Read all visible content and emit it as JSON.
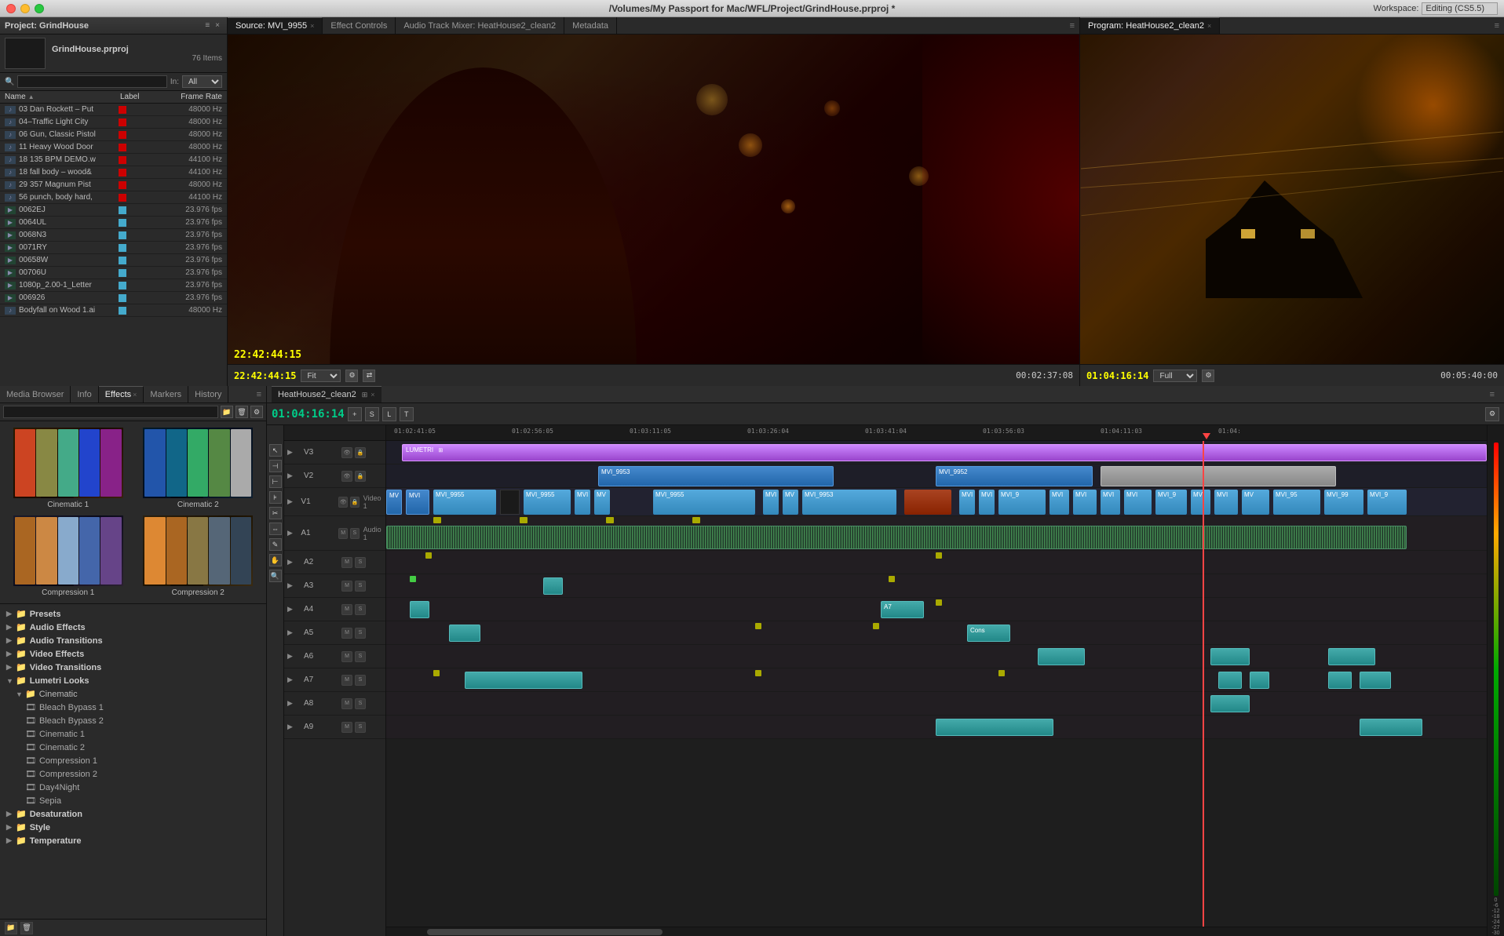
{
  "window": {
    "title": "/Volumes/My Passport for Mac/WFL/Project/GrindHouse.prproj *",
    "workspace_label": "Workspace:",
    "workspace_value": "Editing (CS5.5)"
  },
  "window_controls": {
    "close": "●",
    "minimize": "●",
    "maximize": "●"
  },
  "project_panel": {
    "title": "Project: GrindHouse",
    "close_btn": "×",
    "menu_btn": "≡",
    "project_name": "GrindHouse.prproj",
    "item_count": "76 Items",
    "search_placeholder": "",
    "in_label": "In:",
    "in_value": "All",
    "columns": {
      "name": "Name",
      "label": "Label",
      "frame_rate": "Frame Rate"
    },
    "items": [
      {
        "name": "03 Dan Rockett – Put",
        "color": "#cc0000",
        "rate": "48000 Hz",
        "type": "audio"
      },
      {
        "name": "04–Traffic Light City",
        "color": "#cc0000",
        "rate": "48000 Hz",
        "type": "audio"
      },
      {
        "name": "06 Gun, Classic Pistol",
        "color": "#cc0000",
        "rate": "48000 Hz",
        "type": "audio"
      },
      {
        "name": "11 Heavy Wood Door",
        "color": "#cc0000",
        "rate": "48000 Hz",
        "type": "audio"
      },
      {
        "name": "18 135 BPM DEMO.w",
        "color": "#cc0000",
        "rate": "44100 Hz",
        "type": "audio"
      },
      {
        "name": "18 fall body – wood&",
        "color": "#cc0000",
        "rate": "44100 Hz",
        "type": "audio"
      },
      {
        "name": "29 357 Magnum Pist",
        "color": "#cc0000",
        "rate": "48000 Hz",
        "type": "audio"
      },
      {
        "name": "56 punch, body hard,",
        "color": "#cc0000",
        "rate": "44100 Hz",
        "type": "audio"
      },
      {
        "name": "0062EJ",
        "color": "#44aacc",
        "rate": "23.976 fps",
        "type": "video"
      },
      {
        "name": "0064UL",
        "color": "#44aacc",
        "rate": "23.976 fps",
        "type": "video"
      },
      {
        "name": "0068N3",
        "color": "#44aacc",
        "rate": "23.976 fps",
        "type": "video"
      },
      {
        "name": "0071RY",
        "color": "#44aacc",
        "rate": "23.976 fps",
        "type": "video"
      },
      {
        "name": "00658W",
        "color": "#44aacc",
        "rate": "23.976 fps",
        "type": "video"
      },
      {
        "name": "00706U",
        "color": "#44aacc",
        "rate": "23.976 fps",
        "type": "video"
      },
      {
        "name": "1080p_2.00-1_Letter",
        "color": "#44aacc",
        "rate": "23.976 fps",
        "type": "video"
      },
      {
        "name": "006926",
        "color": "#44aacc",
        "rate": "23.976 fps",
        "type": "video"
      },
      {
        "name": "Bodyfall on Wood 1.ai",
        "color": "#44aacc",
        "rate": "48000 Hz",
        "type": "audio"
      }
    ]
  },
  "source_panel": {
    "tabs": [
      {
        "label": "Source: MVI_9955",
        "active": true,
        "closeable": true
      },
      {
        "label": "Effect Controls",
        "active": false,
        "closeable": false
      },
      {
        "label": "Audio Track Mixer: HeatHouse2_clean2",
        "active": false,
        "closeable": false
      },
      {
        "label": "Metadata",
        "active": false,
        "closeable": false
      }
    ],
    "timecode": "22:42:44:15",
    "fit_label": "Fit",
    "duration": "00:02:37:08"
  },
  "program_panel": {
    "title": "Program: HeatHouse2_clean2",
    "tabs": [
      {
        "label": "Program: HeatHouse2_clean2",
        "active": true,
        "closeable": true
      }
    ],
    "timecode": "01:04:16:14",
    "fit_label": "Full",
    "duration": "00:05:40:00"
  },
  "effects_panel": {
    "tabs": [
      {
        "label": "Media Browser",
        "active": false
      },
      {
        "label": "Info",
        "active": false
      },
      {
        "label": "Effects",
        "active": true
      },
      {
        "label": "Markers",
        "active": false
      },
      {
        "label": "History",
        "active": false
      }
    ],
    "tree": [
      {
        "label": "Presets",
        "type": "category",
        "expanded": false
      },
      {
        "label": "Audio Effects",
        "type": "category",
        "expanded": false
      },
      {
        "label": "Audio Transitions",
        "type": "category",
        "expanded": false
      },
      {
        "label": "Video Effects",
        "type": "category",
        "expanded": false
      },
      {
        "label": "Video Transitions",
        "type": "category",
        "expanded": false
      },
      {
        "label": "Lumetri Looks",
        "type": "category",
        "expanded": true
      },
      {
        "label": "Cinematic",
        "type": "sub-category",
        "expanded": true
      },
      {
        "label": "Bleach Bypass 1",
        "type": "leaf"
      },
      {
        "label": "Bleach Bypass 2",
        "type": "leaf"
      },
      {
        "label": "Cinematic 1",
        "type": "leaf"
      },
      {
        "label": "Cinematic 2",
        "type": "leaf"
      },
      {
        "label": "Compression 1",
        "type": "leaf"
      },
      {
        "label": "Compression 2",
        "type": "leaf"
      },
      {
        "label": "Day4Night",
        "type": "leaf"
      },
      {
        "label": "Sepia",
        "type": "leaf"
      },
      {
        "label": "Desaturation",
        "type": "category",
        "expanded": false
      },
      {
        "label": "Style",
        "type": "category",
        "expanded": false
      },
      {
        "label": "Temperature",
        "type": "category",
        "expanded": false
      }
    ],
    "thumbnails": [
      {
        "label": "Cinematic 1",
        "style": "cinema1"
      },
      {
        "label": "Cinematic 2",
        "style": "cinema2"
      },
      {
        "label": "Compression 1",
        "style": "comp1"
      },
      {
        "label": "Compression 2",
        "style": "comp2"
      }
    ]
  },
  "timeline_panel": {
    "tab_label": "HeatHouse2_clean2",
    "timecode": "01:04:16:14",
    "ruler_marks": [
      "01:02:41:05",
      "01:02:56:05",
      "01:03:11:05",
      "01:03:26:04",
      "01:03:41:04",
      "01:03:56:03",
      "01:04:11:03",
      "01:04:"
    ],
    "tracks": [
      {
        "id": "V3",
        "type": "video",
        "label": "V3"
      },
      {
        "id": "V2",
        "type": "video",
        "label": "V2"
      },
      {
        "id": "V1",
        "type": "video",
        "label": "V1",
        "sub": "Video 1"
      },
      {
        "id": "A1",
        "type": "audio",
        "label": "A1",
        "sub": "Audio 1"
      },
      {
        "id": "A2",
        "type": "audio",
        "label": "A2"
      },
      {
        "id": "A3",
        "type": "audio",
        "label": "A3"
      },
      {
        "id": "A4",
        "type": "audio",
        "label": "A4"
      },
      {
        "id": "A5",
        "type": "audio",
        "label": "A5"
      },
      {
        "id": "A6",
        "type": "audio",
        "label": "A6"
      },
      {
        "id": "A7",
        "type": "audio",
        "label": "A7"
      },
      {
        "id": "A8",
        "type": "audio",
        "label": "A8"
      },
      {
        "id": "A9",
        "type": "audio",
        "label": "A9"
      }
    ]
  }
}
